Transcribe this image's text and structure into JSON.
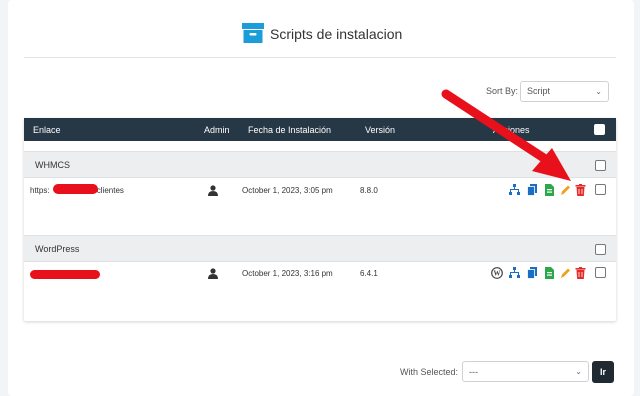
{
  "page": {
    "title": "Scripts de instalacion"
  },
  "sort": {
    "label": "Sort By:",
    "value": "Script"
  },
  "table": {
    "headers": {
      "link": "Enlace",
      "admin": "Admin",
      "date": "Fecha de Instalación",
      "version": "Versión",
      "actions": "Acciones"
    },
    "groups": [
      {
        "name": "WHMCS",
        "rows": [
          {
            "link_prefix": "https:",
            "link_suffix": "/clientes",
            "date": "October 1, 2023, 3:05 pm",
            "version": "8.8.0"
          }
        ]
      },
      {
        "name": "WordPress",
        "rows": [
          {
            "date": "October 1, 2023, 3:16 pm",
            "version": "6.4.1"
          }
        ]
      }
    ]
  },
  "bulk": {
    "label": "With Selected:",
    "value": "---",
    "go_label": "Ir"
  },
  "colors": {
    "header_bg": "#263746",
    "blue": "#1a6fc4",
    "green": "#2aa84a",
    "orange": "#f0a020",
    "red": "#e32b2b",
    "annotation_red": "#e8101b"
  },
  "icons": [
    "archive-icon",
    "user-icon",
    "sitemap-icon",
    "copy-icon",
    "file-export-icon",
    "pencil-icon",
    "trash-icon",
    "wordpress-icon",
    "chevron-down-icon"
  ]
}
